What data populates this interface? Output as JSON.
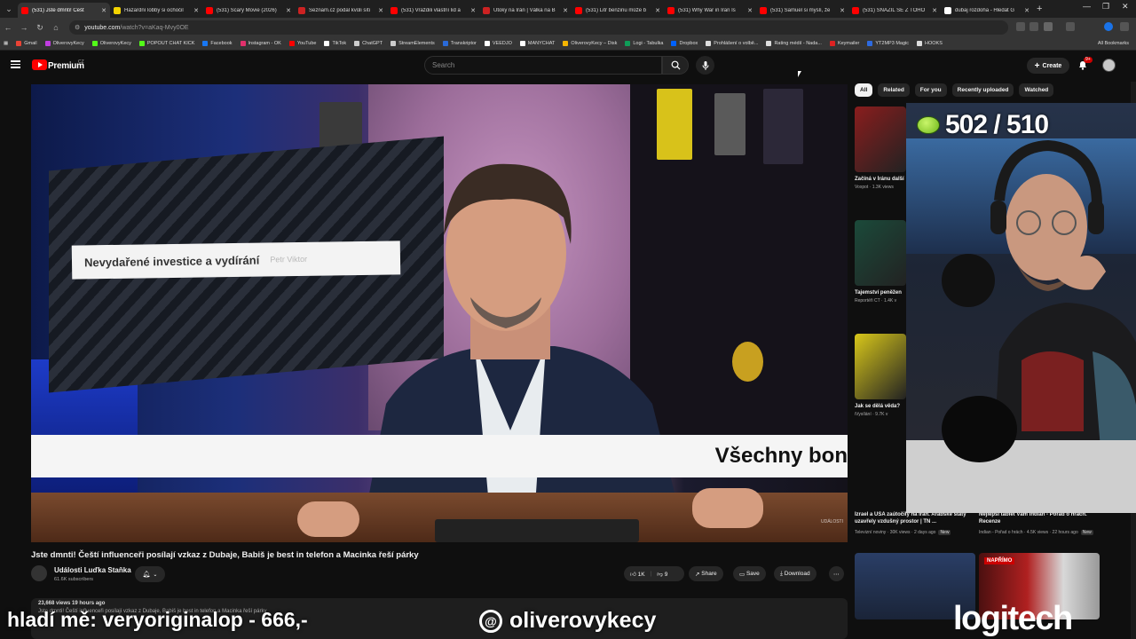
{
  "browser": {
    "tabs": [
      {
        "title": "(531) Jste dmnti! Češt",
        "active": true,
        "color": "#ff0000"
      },
      {
        "title": "Hazardní lobby si ochočil",
        "active": false,
        "color": "#f2d300"
      },
      {
        "title": "(531) Scary Movie (2026)",
        "active": false,
        "color": "#ff0000"
      },
      {
        "title": "Seznam.cz podal kvůli síti",
        "active": false,
        "color": "#cc2222"
      },
      {
        "title": "(531) Vraždili vlastní lid a",
        "active": false,
        "color": "#ff0000"
      },
      {
        "title": "Útoky na Írán | Válka na B",
        "active": false,
        "color": "#cc2222"
      },
      {
        "title": "(531) Litr benzinu může b",
        "active": false,
        "color": "#ff0000"
      },
      {
        "title": "(531) Why War in Iran Is",
        "active": false,
        "color": "#ff0000"
      },
      {
        "title": "(531) Samuel si myslí, že",
        "active": false,
        "color": "#ff0000"
      },
      {
        "title": "(531) SNAŽIL SE Z TOHO",
        "active": false,
        "color": "#ff0000"
      },
      {
        "title": "dubaj rozdoha - Hledat G",
        "active": false,
        "color": "#ffffff"
      }
    ],
    "url_host": "youtube.com",
    "url_path": "/watch?v=aKaq-Mvy0OE",
    "bookmarks": [
      {
        "label": "Gmail",
        "color": "#ea4335"
      },
      {
        "label": "OliverovyKecy",
        "color": "#c03de0"
      },
      {
        "label": "OliverovyKecy",
        "color": "#53fc18"
      },
      {
        "label": "POPOUT CHAT KICK",
        "color": "#53fc18"
      },
      {
        "label": "Facebook",
        "color": "#1877f2"
      },
      {
        "label": "Instagram - OK",
        "color": "#e1306c"
      },
      {
        "label": "YouTube",
        "color": "#ff0000"
      },
      {
        "label": "TikTok",
        "color": "#ffffff"
      },
      {
        "label": "ChatGPT",
        "color": "#cccccc"
      },
      {
        "label": "StreamElements",
        "color": "#cccccc"
      },
      {
        "label": "Transkriptor",
        "color": "#2a6ad8"
      },
      {
        "label": "VEEDJO",
        "color": "#ffffff"
      },
      {
        "label": "MANYCHAT",
        "color": "#ffffff"
      },
      {
        "label": "OliverovyKecy – Disk",
        "color": "#f4b400"
      },
      {
        "label": "Logi - Tabulka",
        "color": "#0f9d58"
      },
      {
        "label": "Dropbox",
        "color": "#0061fe"
      },
      {
        "label": "Prohlášení o volbě...",
        "color": "#dddddd"
      },
      {
        "label": "Rating médií - Nada...",
        "color": "#dddddd"
      },
      {
        "label": "Keymailer",
        "color": "#dd2222"
      },
      {
        "label": "YT2MP3 Magic",
        "color": "#2d6ae0"
      },
      {
        "label": "HOOKS",
        "color": "#dddddd"
      }
    ],
    "all_bookmarks": "All Bookmarks"
  },
  "youtube": {
    "premium_label": "Premium",
    "region": "CZ",
    "search_placeholder": "Search",
    "create_label": "Create",
    "notifications_badge": "9+",
    "video": {
      "banner_text": "Nevydařené investice a vydírání",
      "subtitle_text": "Všechny bon",
      "title": "Jste dmnti! Čeští influenceři posílají vzkaz z Dubaje, Babiš je best in telefon a Macinka řeší párky",
      "channel": "Události Luďka Staňka",
      "subscribers": "61.6K subscribers",
      "likes": "1K",
      "dislikes": "9",
      "share": "Share",
      "save": "Save",
      "download": "Download",
      "views_line": "23,668 views  19 hours ago",
      "desc_line": "Jste dmnti! Čeští influenceři posílají vzkaz z Dubaje, Babiš je best in telefon a Macinka řeší párky"
    },
    "chips": [
      {
        "label": "All",
        "active": true
      },
      {
        "label": "Related",
        "active": false
      },
      {
        "label": "For you",
        "active": false
      },
      {
        "label": "Recently uploaded",
        "active": false
      },
      {
        "label": "Watched",
        "active": false
      }
    ],
    "recommendations": [
      {
        "title": "Začíná v Íránu další",
        "meta": "Voxpot · 1.3K views"
      },
      {
        "title": "Tajemství peněžen",
        "meta": "Reportéři ČT · 1.4K v"
      },
      {
        "title": "Jak se dělá věda?",
        "meta": "iVysílání · 9.7K v"
      },
      {
        "title": "Izrael a USA zaútočily na Írán. Arabské státy uzavřely vzdušný prostor | TN ...",
        "meta": "Televizní noviny · 30K views · 2 days ago",
        "badge": "New"
      },
      {
        "title": "Nejlepší tablet Vám Indián - Pořad o hrách. Recenze",
        "meta": "Indian - Pořad o hrách · 4.5K views · 22 hours ago",
        "badge": "New"
      }
    ],
    "mini_live_label": "NAPŘÍMO"
  },
  "stream_overlay": {
    "counter": "502 / 510",
    "bottom_left": "hladí mě: veryoriginalop - 666,-",
    "threads_handle": "oliverovykecy",
    "sponsor": "logitech"
  }
}
